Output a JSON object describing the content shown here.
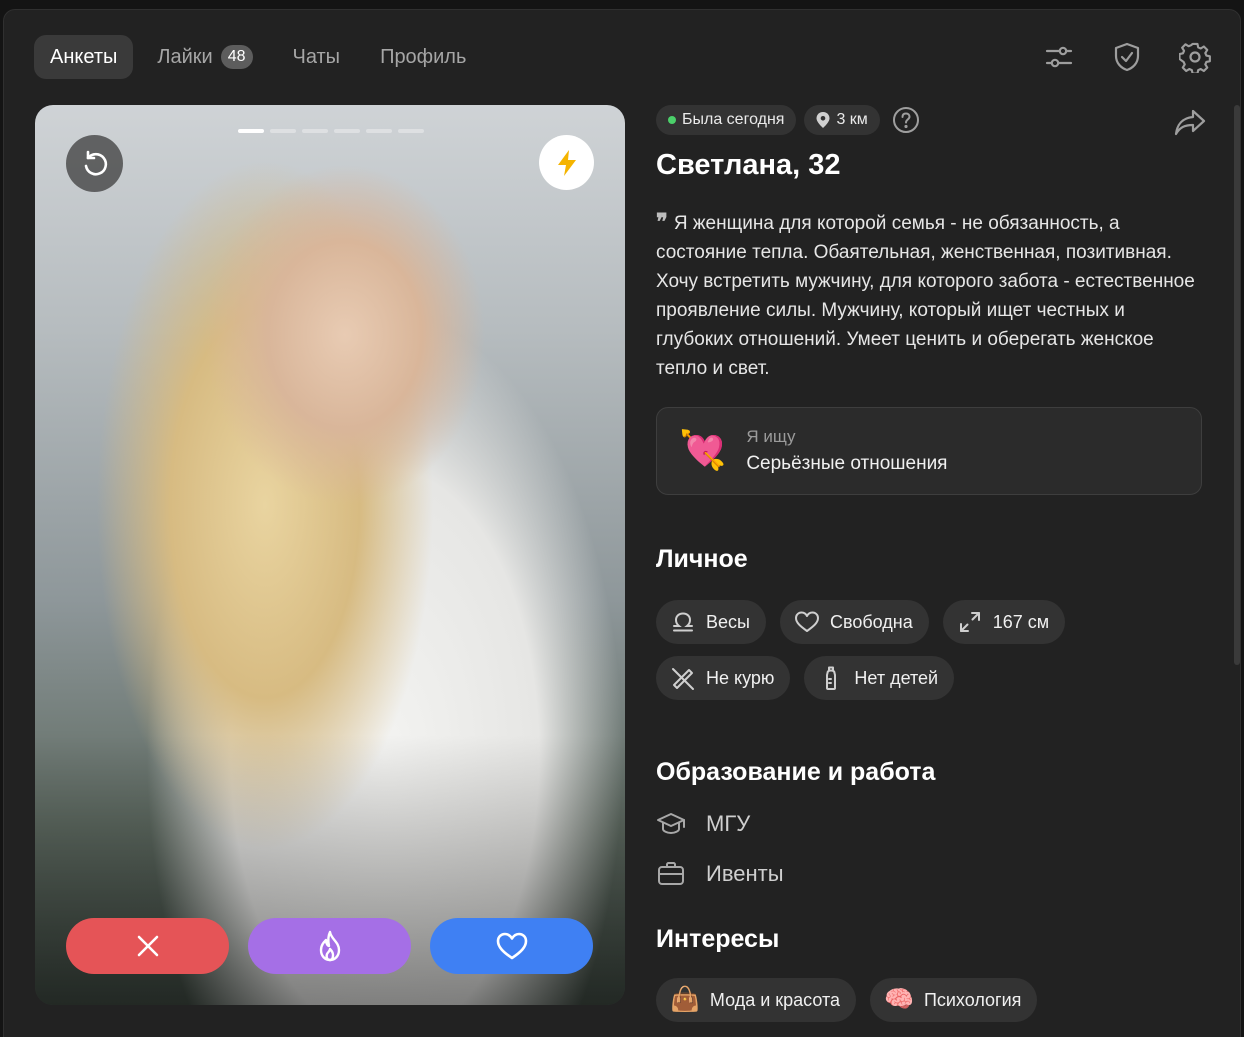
{
  "nav": {
    "tabs": [
      {
        "label": "Анкеты",
        "active": true
      },
      {
        "label": "Лайки",
        "badge": "48"
      },
      {
        "label": "Чаты"
      },
      {
        "label": "Профиль"
      }
    ],
    "icons": [
      "filters-icon",
      "shield-icon",
      "gear-icon"
    ]
  },
  "photo": {
    "photo_count": 6,
    "active_index": 0
  },
  "profile": {
    "status": "Была сегодня",
    "distance": "3 км",
    "name": "Светлана, 32",
    "bio": "Я женщина для которой семья - не обязанность, а состояние тепла. Обаятельная, женственная, позитивная. Хочу встретить мужчину, для которого забота - естественное проявление силы. Мужчину, который ищет честных и глубоких отношений. Умеет ценить и оберегать женское тепло и свет.",
    "looking_for_label": "Я ищу",
    "looking_for_value": "Серьёзные отношения",
    "looking_for_emoji": "💘"
  },
  "personal": {
    "title": "Личное",
    "items": [
      {
        "label": "Весы",
        "icon": "libra-icon"
      },
      {
        "label": "Свободна",
        "icon": "heart-outline-icon"
      },
      {
        "label": "167 см",
        "icon": "height-arrows-icon"
      },
      {
        "label": "Не курю",
        "icon": "no-smoking-icon"
      },
      {
        "label": "Нет детей",
        "icon": "baby-bottle-icon"
      }
    ]
  },
  "education": {
    "title": "Образование и работа",
    "items": [
      {
        "label": "МГУ",
        "icon": "graduation-cap-icon"
      },
      {
        "label": "Ивенты",
        "icon": "briefcase-icon"
      }
    ]
  },
  "interests": {
    "title": "Интересы",
    "items": [
      {
        "label": "Мода и красота",
        "emoji": "👜"
      },
      {
        "label": "Психология",
        "emoji": "🧠"
      }
    ]
  },
  "colors": {
    "dislike": "#e55457",
    "superlike": "#a56fe6",
    "like": "#3f80f3",
    "online": "#4bd06a",
    "boost": "#f5b400"
  }
}
